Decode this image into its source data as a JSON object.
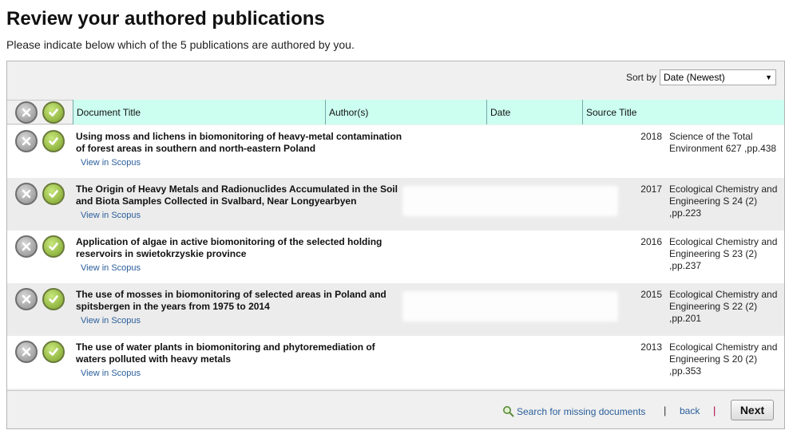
{
  "page": {
    "title": "Review your authored publications",
    "subtitle": "Please indicate below which of the 5 publications are authored by you."
  },
  "sort": {
    "label": "Sort by",
    "selected": "Date (Newest)"
  },
  "table": {
    "columns": [
      "Document Title",
      "Author(s)",
      "Date",
      "Source Title"
    ],
    "rows": [
      {
        "title": "Using moss and lichens in biomonitoring of heavy-metal contamination of forest areas in southern and north-eastern Poland",
        "link": "View in Scopus",
        "date": "2018",
        "source": "Science of the Total Environment 627 ,pp.438"
      },
      {
        "title": "The Origin of Heavy Metals and Radionuclides Accumulated in the Soil and Biota Samples Collected in Svalbard, Near Longyearbyen",
        "link": "View in Scopus",
        "date": "2017",
        "source": "Ecological Chemistry and Engineering S 24 (2) ,pp.223"
      },
      {
        "title": "Application of algae in active biomonitoring of the selected holding reservoirs in swietokrzyskie province",
        "link": "View in Scopus",
        "date": "2016",
        "source": "Ecological Chemistry and Engineering S 23 (2) ,pp.237"
      },
      {
        "title": "The use of mosses in biomonitoring of selected areas in Poland and spitsbergen in the years from 1975 to 2014",
        "link": "View in Scopus",
        "date": "2015",
        "source": "Ecological Chemistry and Engineering S 22 (2) ,pp.201"
      },
      {
        "title": "The use of water plants in biomonitoring and phytoremediation of waters polluted with heavy metals",
        "link": "View in Scopus",
        "date": "2013",
        "source": "Ecological Chemistry and Engineering S 20 (2) ,pp.353"
      }
    ]
  },
  "footer": {
    "search_label": "Search for missing documents",
    "separator": "|",
    "back_label": "back",
    "next_label": "Next"
  },
  "icons": {
    "reject": "x-circle-icon",
    "accept": "check-circle-icon",
    "search": "magnifier-icon"
  },
  "colors": {
    "header_bg": "#ccfff0",
    "link": "#2a5e9a",
    "accept": "#7aa02a"
  }
}
